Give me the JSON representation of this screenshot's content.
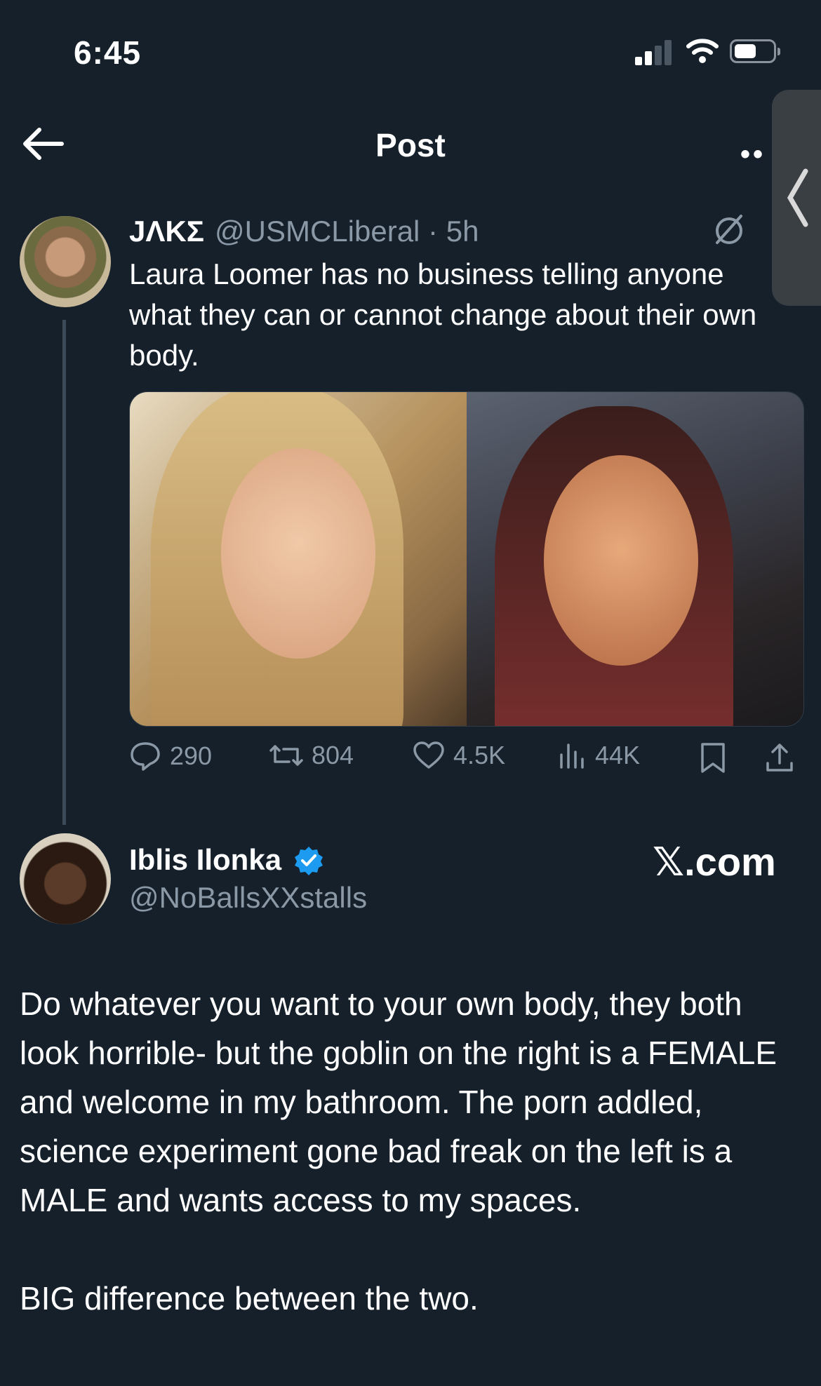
{
  "status_bar": {
    "time": "6:45"
  },
  "header": {
    "title": "Post",
    "more_icon": "ellipsis-icon"
  },
  "tweet1": {
    "name": "JΛKΣ",
    "handle_time": "@USMCLiberal · 5h",
    "text": "Laura Loomer has no business telling anyone what they can or cannot change about their own body.",
    "actions": {
      "replies": "290",
      "reposts": "804",
      "likes": "4.5K",
      "views": "44K"
    }
  },
  "tweet2": {
    "name": "Iblis Ilonka",
    "handle": "@NoBallsXXstalls",
    "brand": "𝕏.com",
    "text": "Do whatever you want to your own body, they both look horrible- but the goblin on the right is a FEMALE and welcome in my bathroom. The porn addled, science experiment gone bad freak on the left is a MALE and wants access to my spaces.\n\nBIG difference between the two."
  },
  "colors": {
    "background": "#15202b",
    "muted": "#8b98a5",
    "verified": "#1d9bf0"
  }
}
